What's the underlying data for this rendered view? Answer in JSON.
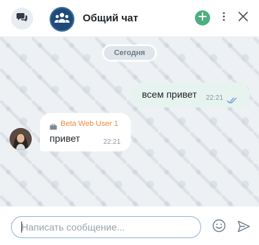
{
  "header": {
    "title": "Общий чат",
    "chats_icon": "chat-bubbles-icon",
    "avatar_icon": "group-users-icon",
    "add_icon": "plus-icon",
    "more_icon": "vertical-dots-icon",
    "close_icon": "close-icon"
  },
  "messages": {
    "date_label": "Сегодня",
    "outgoing": {
      "text": "всем привет",
      "time": "22:21",
      "status_icon": "double-check-icon"
    },
    "incoming": {
      "sender": "Beta Web User 1",
      "sender_icon": "briefcase-icon",
      "text": "привет",
      "time": "22:21"
    }
  },
  "composer": {
    "placeholder": "Написать сообщение...",
    "value": "",
    "emoji_icon": "smiley-icon",
    "send_icon": "send-icon"
  },
  "colors": {
    "accent_green": "#4caf7d",
    "sender_orange": "#f08a3c",
    "outgoing_bubble": "#e6f3ef",
    "input_border": "#8fb0d6"
  }
}
